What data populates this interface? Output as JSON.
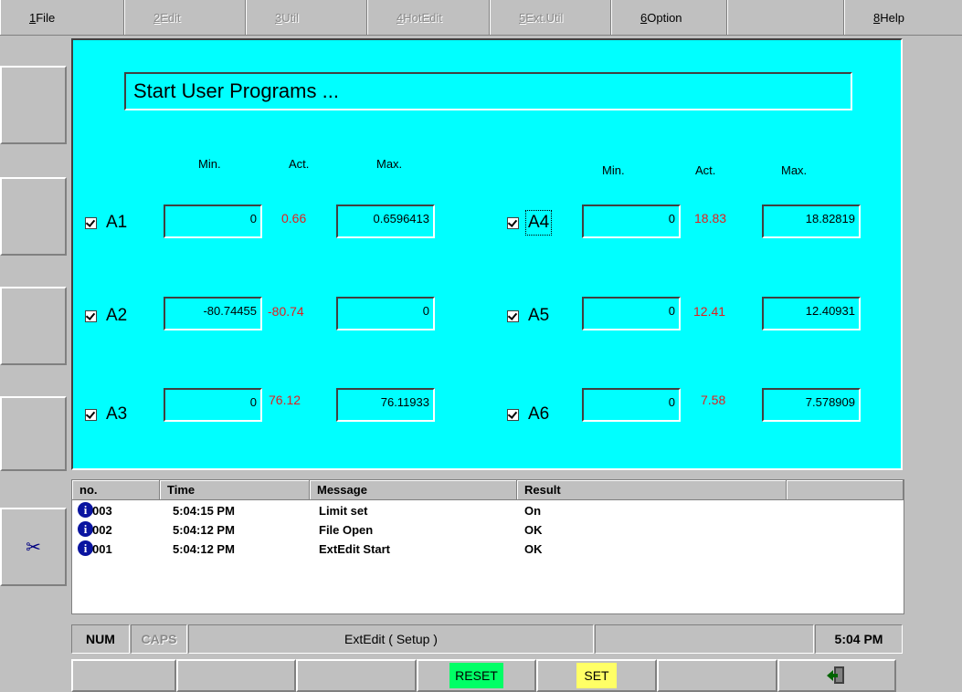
{
  "menu": [
    {
      "key": "1",
      "label": "File",
      "enabled": true
    },
    {
      "key": "2",
      "label": "Edit",
      "enabled": false
    },
    {
      "key": "3",
      "label": "Util",
      "enabled": false
    },
    {
      "key": "4",
      "label": "HotEdit",
      "enabled": false
    },
    {
      "key": "5",
      "label": "Ext.Util",
      "enabled": false
    },
    {
      "key": "6",
      "label": "Option",
      "enabled": true
    },
    {
      "key": "8",
      "label": "Help",
      "enabled": true
    }
  ],
  "panel": {
    "title": "Start User Programs ...",
    "headers": {
      "min": "Min.",
      "act": "Act.",
      "max": "Max."
    },
    "axes": [
      {
        "name": "A1",
        "checked": true,
        "min": "0",
        "act": "0.66",
        "max": "0.6596413"
      },
      {
        "name": "A2",
        "checked": true,
        "min": "-80.74455",
        "act": "-80.74",
        "max": "0"
      },
      {
        "name": "A3",
        "checked": true,
        "min": "0",
        "act": "76.12",
        "max": "76.11933"
      },
      {
        "name": "A4",
        "checked": true,
        "min": "0",
        "act": "18.83",
        "max": "18.82819"
      },
      {
        "name": "A5",
        "checked": true,
        "min": "0",
        "act": "12.41",
        "max": "12.40931"
      },
      {
        "name": "A6",
        "checked": true,
        "min": "0",
        "act": "7.58",
        "max": "7.578909"
      }
    ]
  },
  "log": {
    "columns": [
      "no.",
      "Time",
      "Message",
      "Result"
    ],
    "rows": [
      {
        "no": "003",
        "time": "5:04:15 PM",
        "message": "Limit set",
        "result": "On"
      },
      {
        "no": "002",
        "time": "5:04:12 PM",
        "message": "File Open",
        "result": "OK"
      },
      {
        "no": "001",
        "time": "5:04:12 PM",
        "message": "ExtEdit Start",
        "result": "OK"
      }
    ]
  },
  "status": {
    "num": "NUM",
    "caps": "CAPS",
    "mode": "ExtEdit ( Setup )",
    "clock": "5:04 PM"
  },
  "softkeys": {
    "reset": "RESET",
    "set": "SET"
  },
  "colors": {
    "panel": "#00ffff",
    "actual_value": "#e02020",
    "reset_key": "#00ff66",
    "set_key": "#ffff66"
  },
  "icons": {
    "scissors": "scissors-icon",
    "exit": "exit-door-icon",
    "info": "info-icon"
  }
}
